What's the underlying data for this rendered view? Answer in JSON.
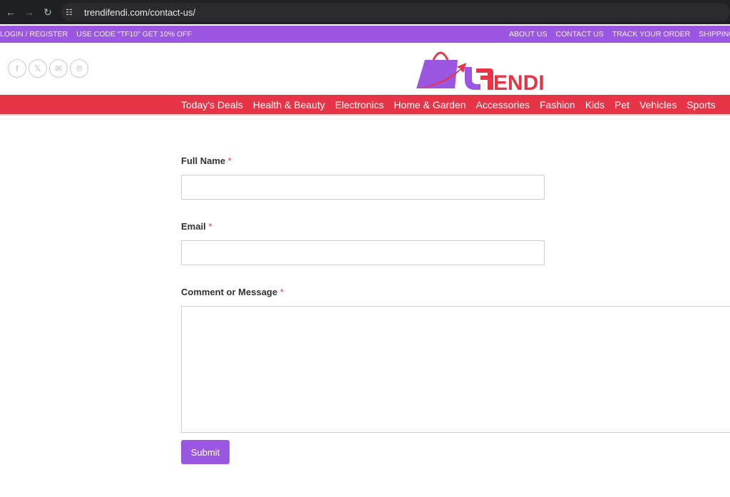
{
  "browser": {
    "url": "trendifendi.com/contact-us/"
  },
  "topbar": {
    "left": [
      "LOGIN / REGISTER",
      "USE CODE \"TF10\" GET 10% OFF"
    ],
    "right": [
      "ABOUT US",
      "CONTACT US",
      "TRACK YOUR ORDER",
      "SHIPPING I"
    ]
  },
  "logo": {
    "text": "tFENDI",
    "colors": {
      "purple": "#9b57e1",
      "red": "#e73446"
    }
  },
  "social": [
    "facebook-icon",
    "x-icon",
    "email-icon",
    "pinterest-icon"
  ],
  "nav": [
    "Today's Deals",
    "Health & Beauty",
    "Electronics",
    "Home & Garden",
    "Accessories",
    "Fashion",
    "Kids",
    "Pet",
    "Vehicles",
    "Sports"
  ],
  "form": {
    "full_name": "Full Name",
    "email": "Email",
    "message": "Comment or Message",
    "required": "*",
    "submit": "Submit"
  }
}
